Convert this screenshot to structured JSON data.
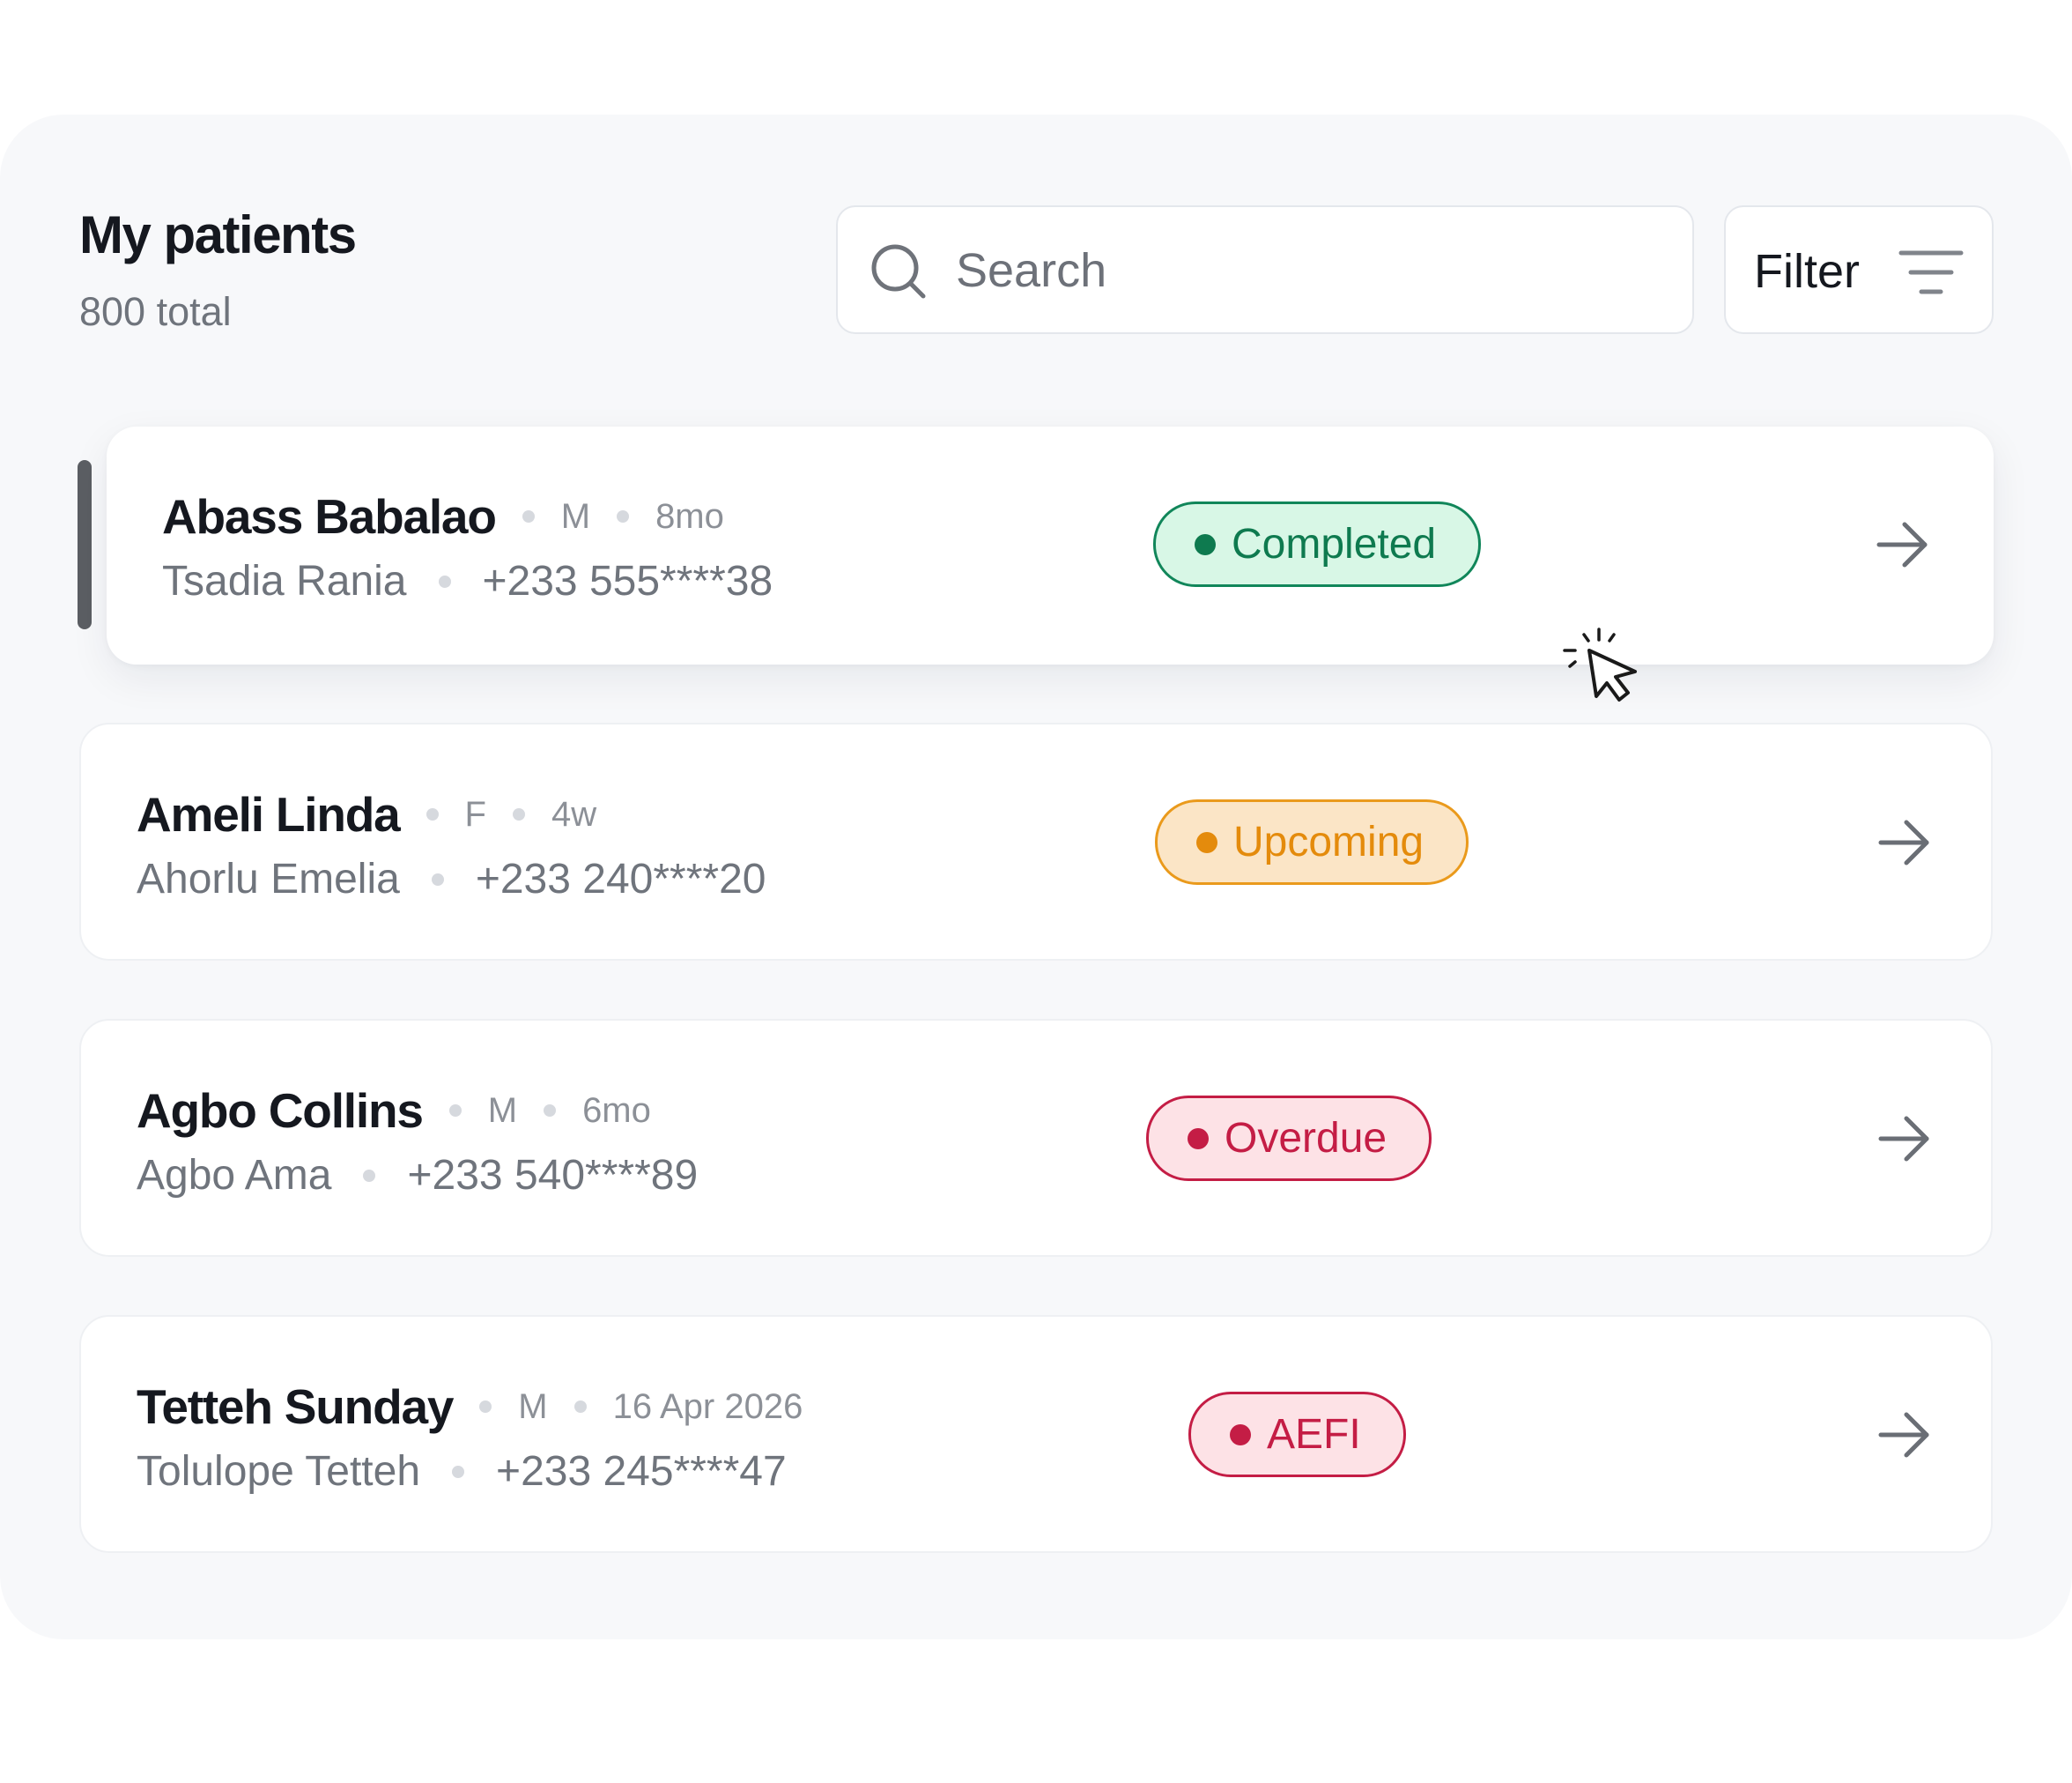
{
  "header": {
    "title": "My patients",
    "total": "800 total"
  },
  "search": {
    "placeholder": "Search"
  },
  "filter": {
    "label": "Filter",
    "icon": "filter-lines-icon"
  },
  "colors": {
    "panel_bg": "#f7f8fa",
    "completed": {
      "text": "#0e7a4f",
      "bg": "#d8f7e6",
      "border": "#11865a",
      "dot": "#0e7a4f"
    },
    "upcoming": {
      "text": "#e48b0c",
      "bg": "#fbe5c6",
      "border": "#ea9a1c",
      "dot": "#e48b0c"
    },
    "overdue": {
      "text": "#c41d45",
      "bg": "#fde2e6",
      "border": "#c41d45",
      "dot": "#c41d45"
    },
    "aefi": {
      "text": "#c41d45",
      "bg": "#fde2e6",
      "border": "#c41d45",
      "dot": "#c41d45"
    }
  },
  "patients": [
    {
      "name": "Abass Babalao",
      "sex": "M",
      "age": "8mo",
      "guardian": "Tsadia Rania",
      "phone": "+233 555****38",
      "status": "Completed",
      "selected": true
    },
    {
      "name": "Ameli Linda",
      "sex": "F",
      "age": "4w",
      "guardian": "Ahorlu Emelia",
      "phone": "+233 240****20",
      "status": "Upcoming",
      "selected": false
    },
    {
      "name": "Agbo Collins",
      "sex": "M",
      "age": "6mo",
      "guardian": "Agbo Ama",
      "phone": "+233 540****89",
      "status": "Overdue",
      "selected": false
    },
    {
      "name": "Tetteh Sunday",
      "sex": "M",
      "age": "16 Apr 2026",
      "guardian": "Tolulope Tetteh",
      "phone": "+233 245****47",
      "status": "AEFI",
      "selected": false
    }
  ]
}
